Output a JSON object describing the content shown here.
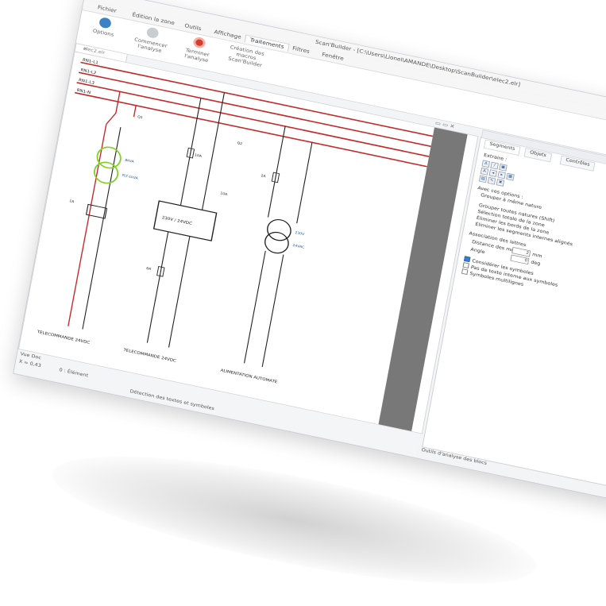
{
  "window": {
    "title": "Scan'Builder - [C:\\Users\\Lionel\\AMANDE\\Desktop\\ScanBuilder\\elec2.elr]"
  },
  "menu": {
    "items": [
      "Fichier",
      "Édition la zone",
      "Outils",
      "Affichage",
      "Traitements",
      "Filtres",
      "Fenêtre"
    ],
    "active_index": 4
  },
  "ribbon": {
    "options_label": "Options",
    "commencer_label": "Commencer l'analyse",
    "terminer_label": "Terminer l'analyse",
    "creation_label": "Création des macros Scan'Builder"
  },
  "document": {
    "tab_label": "elec2.elr"
  },
  "schematic": {
    "bus_labels": [
      "RN1-L1",
      "RN1-L2",
      "RN1-L3",
      "RN1-N"
    ],
    "transformer_labels": [
      "8kVA",
      "PLT-1kVA"
    ],
    "converter_label": "230V / 24VDC",
    "right_transformer_labels": [
      "230V",
      "24VAC"
    ],
    "feeder_labels": [
      "TELECOMMANDE 24VDC",
      "TELECOMMANDE 24VDC",
      "ALIMENTATION AUTOMATE"
    ],
    "small_labels": [
      "1A",
      "10A",
      "6A",
      "2A",
      "10A",
      "Q1",
      "Q2"
    ]
  },
  "status": {
    "coords": "X = 0,43",
    "selection": "0 : Élément",
    "message": "Détection des textes et symboles",
    "tab_label": "Vue Doc"
  },
  "panel": {
    "tabs": [
      "Segments",
      "Objets",
      "Contrôles"
    ],
    "extract_label": "Extraire :",
    "options_label": "Avec ces options :",
    "group_label": "Grouper à même nature",
    "grouper_toutes": "Grouper toutes natures (Shift)",
    "selection_totale": "Sélection totale de la zone",
    "eliminer_bords": "Éliminer les bords de la zone",
    "eliminer_segments": "Éliminer les segments internes alignés",
    "association_label": "Association des lettres",
    "distance_label": "Distance des mots",
    "distance_value": "2",
    "distance_unit": "mm",
    "angle_label": "Angle",
    "angle_value": "0",
    "angle_unit": "deg",
    "check_symboles": "Considérer les symboles",
    "check_pas_texte": "Pas de texte interne aux symboles",
    "check_multilignes": "Symboles multilignes",
    "footer": "Outils d'analyse des blocs"
  },
  "colors": {
    "bus_line": "#c32b2b",
    "highlight": "#7ed321",
    "accent": "#3b82c4"
  }
}
